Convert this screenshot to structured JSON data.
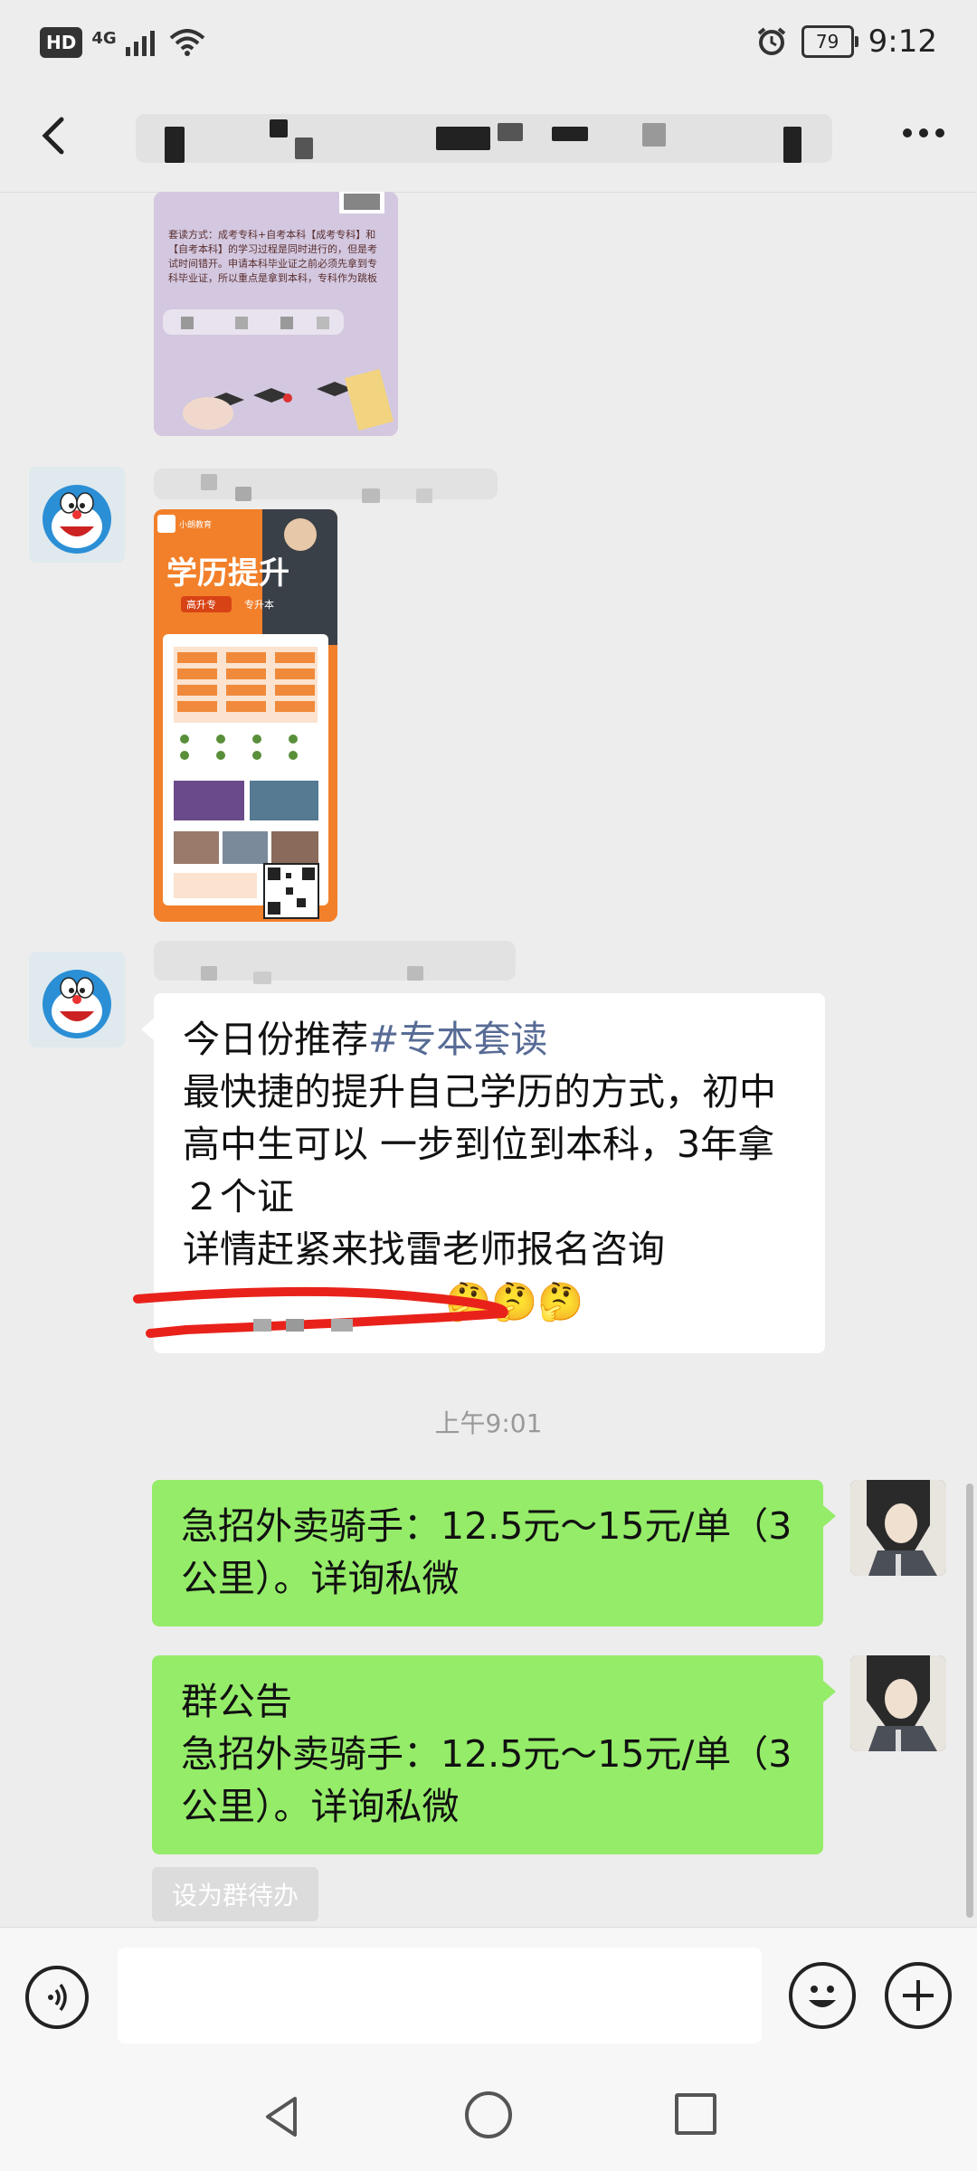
{
  "status_bar": {
    "hd": "HD",
    "network": "4G",
    "battery": "79",
    "time": "9:12"
  },
  "header": {
    "back_icon": "chevron-left-icon",
    "more_icon": "more-dots-icon"
  },
  "messages": [
    {
      "type": "image",
      "sender": "other",
      "image_text": "套读方式：成考专科+自考本科【成考专科】和【自考本科】的学习过程是同时进行的，但是考试时间错开。申请本科毕业证之前必须先拿到专科毕业证，所以重点是拿到本科，专科作为跳板"
    },
    {
      "type": "image",
      "sender": "other",
      "image_title": "学历提升",
      "image_tags": [
        "高升专",
        "专升本"
      ],
      "image_brand": "小朗教育"
    },
    {
      "type": "text",
      "sender": "other",
      "text_prefix": "今日份推荐",
      "hashtag": "#专本套读",
      "text_body": "最快捷的提升自己学历的方式，初中高中生可以 一步到位到本科，3年拿２个证\n详情赶紧来找雷老师报名咨询",
      "emoji": "🤔🤔🤔"
    }
  ],
  "time_divider": "上午9:01",
  "sent_messages": [
    {
      "text": "急招外卖骑手：12.5元～15元/单（3公里）。详询私微"
    },
    {
      "text": "群公告\n急招外卖骑手：12.5元～15元/单（3公里）。详询私微"
    }
  ],
  "todo_button": "设为群待办",
  "input": {
    "placeholder": ""
  },
  "colors": {
    "background": "#ededed",
    "sent_bubble": "#95ec69",
    "received_bubble": "#ffffff",
    "hashtag": "#576b95",
    "annotation_red": "#e8221b"
  }
}
